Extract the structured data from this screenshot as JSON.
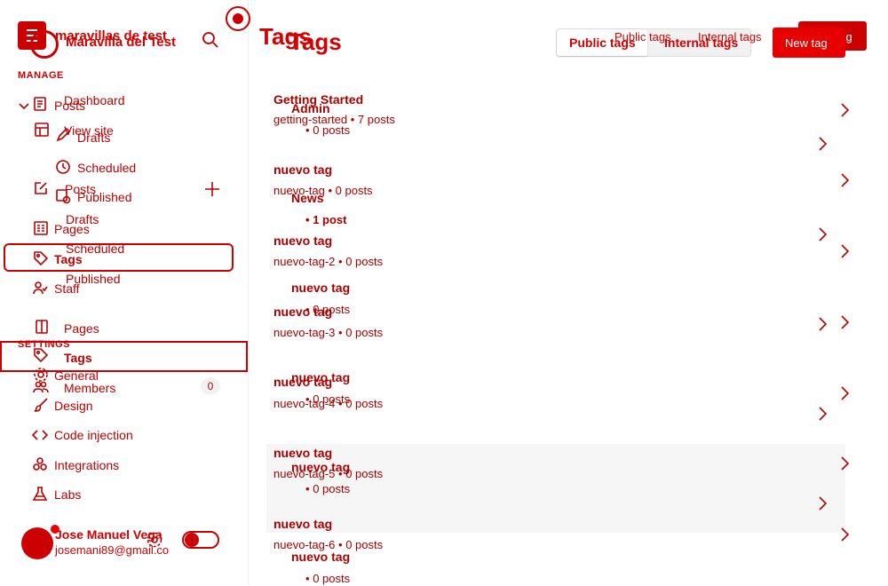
{
  "site": {
    "title_a": "maravillas de test",
    "title_b": "Maravilla del Test"
  },
  "sidebar": {
    "manage_heading": "MANAGE",
    "settings_heading": "SETTINGS",
    "items_a": {
      "posts": "Posts",
      "drafts": "Drafts",
      "scheduled": "Scheduled",
      "published": "Published",
      "pages": "Pages",
      "tags": "Tags",
      "staff": "Staff",
      "general": "General",
      "design": "Design",
      "code_injection": "Code injection",
      "integrations": "Integrations",
      "labs": "Labs"
    },
    "items_b": {
      "dashboard": "Dashboard",
      "view_site": "View site",
      "posts": "Posts",
      "drafts": "Drafts",
      "scheduled": "Scheduled",
      "published": "Published",
      "pages": "Pages",
      "tags": "Tags",
      "members": "Members",
      "members_count": "0"
    },
    "user": {
      "name": "Jose Manuel Vega",
      "email": "josemani89@gmail.co"
    }
  },
  "header": {
    "title_a": "Tags",
    "title_b": "Tags",
    "public_tags_a": "Public tags",
    "internal_tags_a": "Internal tags",
    "new_tag_a": "New tag",
    "public_tags_b": "Public tags",
    "internal_tags_b": "Internal tags",
    "new_tag_b": "New tag"
  },
  "tags_a": [
    {
      "name": "Getting Started",
      "slug": "getting-started",
      "count": "7 posts"
    },
    {
      "name": "nuevo tag",
      "slug": "nuevo-tag",
      "count": "0 posts"
    },
    {
      "name": "nuevo tag",
      "slug": "nuevo-tag-2",
      "count": "0 posts"
    },
    {
      "name": "nuevo tag",
      "slug": "nuevo-tag-3",
      "count": "0 posts"
    },
    {
      "name": "nuevo tag",
      "slug": "nuevo-tag-4",
      "count": "0 posts"
    },
    {
      "name": "nuevo tag",
      "slug": "nuevo-tag-5",
      "count": "0 posts"
    },
    {
      "name": "nuevo tag",
      "slug": "nuevo-tag-6",
      "count": "0 posts"
    }
  ],
  "tags_b": [
    {
      "name": "Admin",
      "count": "0 posts"
    },
    {
      "name": "News",
      "count": "1 post"
    },
    {
      "name": "nuevo tag",
      "count": "0 posts"
    },
    {
      "name": "nuevo tag",
      "count": "0 posts"
    },
    {
      "name": "nuevo tag",
      "count": "0 posts"
    },
    {
      "name": "nuevo tag",
      "count": "0 posts"
    }
  ],
  "separator": "•"
}
